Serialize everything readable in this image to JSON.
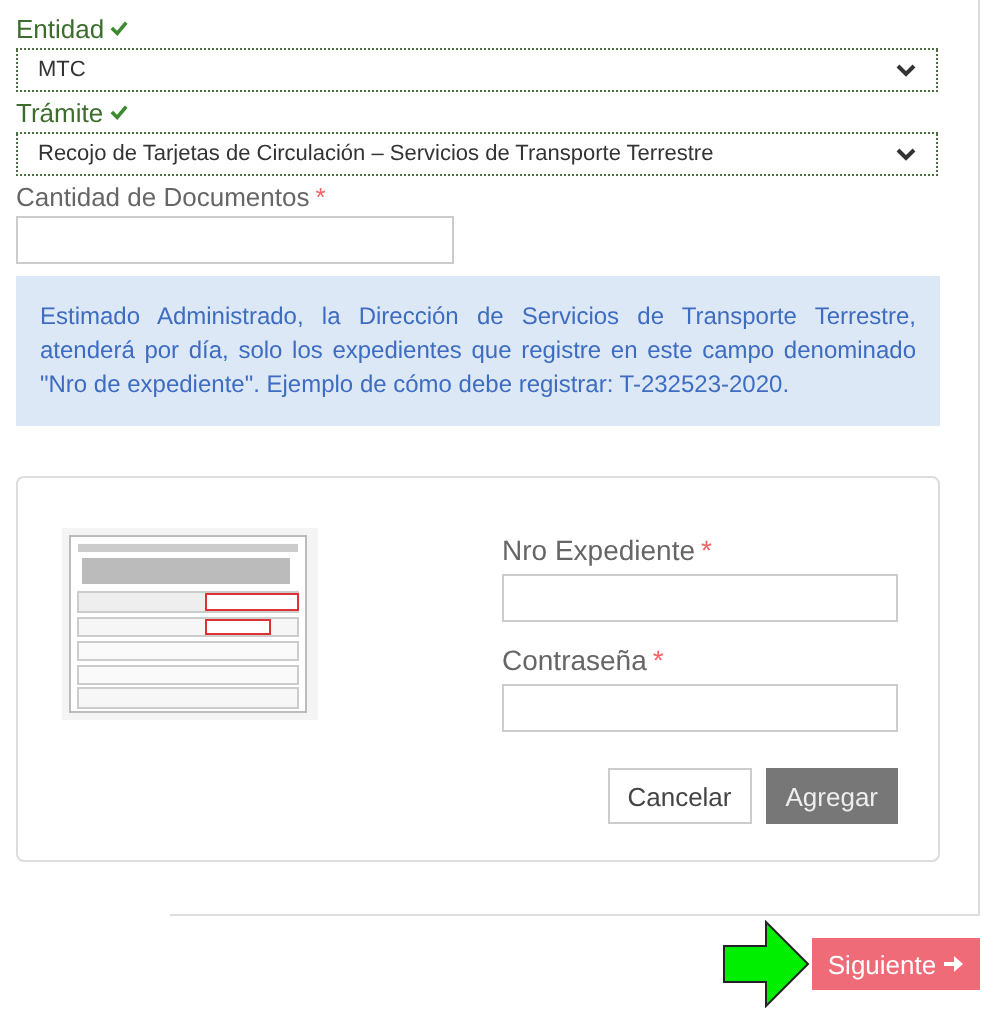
{
  "fields": [
    {
      "label": "Entidad",
      "kind": "select",
      "valid": true,
      "value": "MTC"
    },
    {
      "label": "Trámite",
      "kind": "select",
      "valid": true,
      "value": "Recojo de Tarjetas de Circulación – Servicios de Transporte Terrestre"
    },
    {
      "label": "Cantidad de Documentos",
      "kind": "input",
      "required_mark": "*"
    }
  ],
  "notice": "Estimado Administrado, la Dirección de Servicios de Transporte Terrestre, atenderá por día, solo los expedientes que registre en este campo denominado \"Nro de expediente\". Ejemplo de cómo debe registrar: T-232523-2020.",
  "expediente_form": {
    "fields": [
      {
        "label": "Nro Expediente",
        "required_mark": "*"
      },
      {
        "label": "Contraseña",
        "required_mark": "*"
      }
    ],
    "buttons": [
      {
        "label": "Cancelar",
        "kind": "secondary"
      },
      {
        "label": "Agregar",
        "kind": "primary"
      }
    ]
  },
  "next_button": {
    "label": "Siguiente"
  }
}
